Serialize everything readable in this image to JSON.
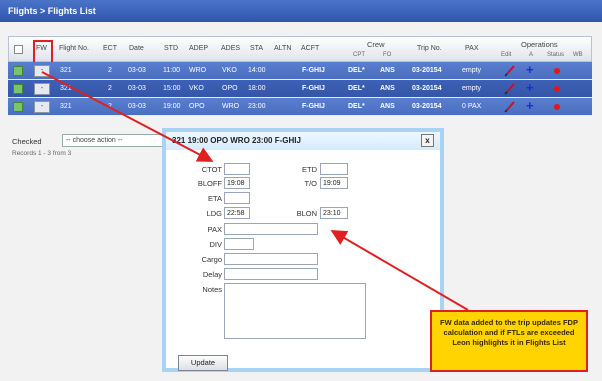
{
  "title": "Flights > Flights List",
  "header": {
    "fw": "FW",
    "flight_no": "Flight No.",
    "ec": "ECT",
    "date": "Date",
    "std": "STD",
    "adep": "ADEP",
    "ades": "ADES",
    "sta": "STA",
    "altn": "ALTN",
    "acft": "ACFT",
    "crew": "Crew",
    "crew_cpt": "CPT",
    "crew_fo": "FO",
    "trip_no": "Trip No.",
    "pax": "PAX",
    "operations": "Operations",
    "op_edit": "Edit",
    "op_a": "A",
    "op_status": "Status",
    "op_wb": "WB"
  },
  "rows": [
    {
      "fw": "-",
      "flight_no": "321",
      "ec": "2",
      "date": "03-03",
      "std": "11:00",
      "adep": "WRO",
      "ades": "VKO",
      "sta": "14:00",
      "acft": "F-GHIJ",
      "cpt": "DEL*",
      "fo": "ANS",
      "trip": "03-20154",
      "pax": "empty"
    },
    {
      "fw": "-",
      "flight_no": "321",
      "ec": "2",
      "date": "03-03",
      "std": "15:00",
      "adep": "VKO",
      "ades": "OPO",
      "sta": "18:00",
      "acft": "F-GHIJ",
      "cpt": "DEL*",
      "fo": "ANS",
      "trip": "03-20154",
      "pax": "empty"
    },
    {
      "fw": "-",
      "flight_no": "321",
      "ec": "2",
      "date": "03-03",
      "std": "19:00",
      "adep": "OPO",
      "ades": "WRO",
      "sta": "23:00",
      "acft": "F-GHIJ",
      "cpt": "DEL*",
      "fo": "ANS",
      "trip": "03-20154",
      "pax": "0 PAX"
    }
  ],
  "footer": {
    "checked_label": "Checked",
    "action_placeholder": "-- choose action --",
    "records": "Records 1 - 3 from 3"
  },
  "popup": {
    "title": "321 19:00 OPO WRO 23:00 F-GHIJ",
    "close": "x",
    "ctot_label": "CTOT",
    "ctot": "",
    "etd_label": "ETD",
    "etd": "",
    "blofp_label": "BLOFF",
    "blofp": "19:08",
    "to_label": "T/O",
    "to": "19:09",
    "eta_label": "ETA",
    "eta": "",
    "ldg_label": "LDG",
    "ldg": "22:58",
    "blon_label": "BLON",
    "blon": "23:10",
    "pax_label": "PAX",
    "pax": "",
    "div_label": "DIV",
    "div": "",
    "cargo_label": "Cargo",
    "cargo": "",
    "delay_label": "Delay",
    "delay": "",
    "notes_label": "Notes",
    "notes": "",
    "update": "Update"
  },
  "note": "FW data added to the trip updates FDP calculation and if FTLs are exceeded Leon highlights it in Flights List",
  "colors": {
    "row": "#4a6ec0",
    "annotation": "#e02020",
    "note_bg": "#ffd400",
    "popup_border": "#a9d3f2"
  }
}
